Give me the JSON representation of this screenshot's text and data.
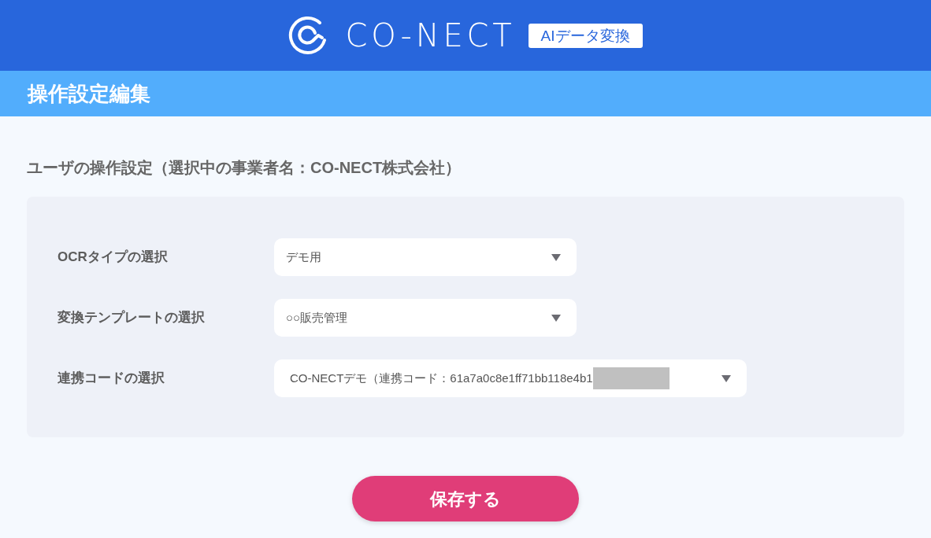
{
  "header": {
    "brand": "CO-NECT",
    "badge": "AIデータ変換"
  },
  "page_title": "操作設定編集",
  "section_title": "ユーザの操作設定（選択中の事業者名：CO-NECT株式会社）",
  "settings": [
    {
      "label": "OCRタイプの選択",
      "value": "デモ用",
      "kind": "short",
      "redacted": false
    },
    {
      "label": "変換テンプレートの選択",
      "value": "○○販売管理",
      "kind": "short",
      "redacted": false
    },
    {
      "label": "連携コードの選択",
      "value": "CO-NECTデモ（連携コード：61a7a0c8e1ff71bb118e4b1",
      "kind": "wide",
      "redacted": true
    }
  ],
  "save_button": "保存する"
}
